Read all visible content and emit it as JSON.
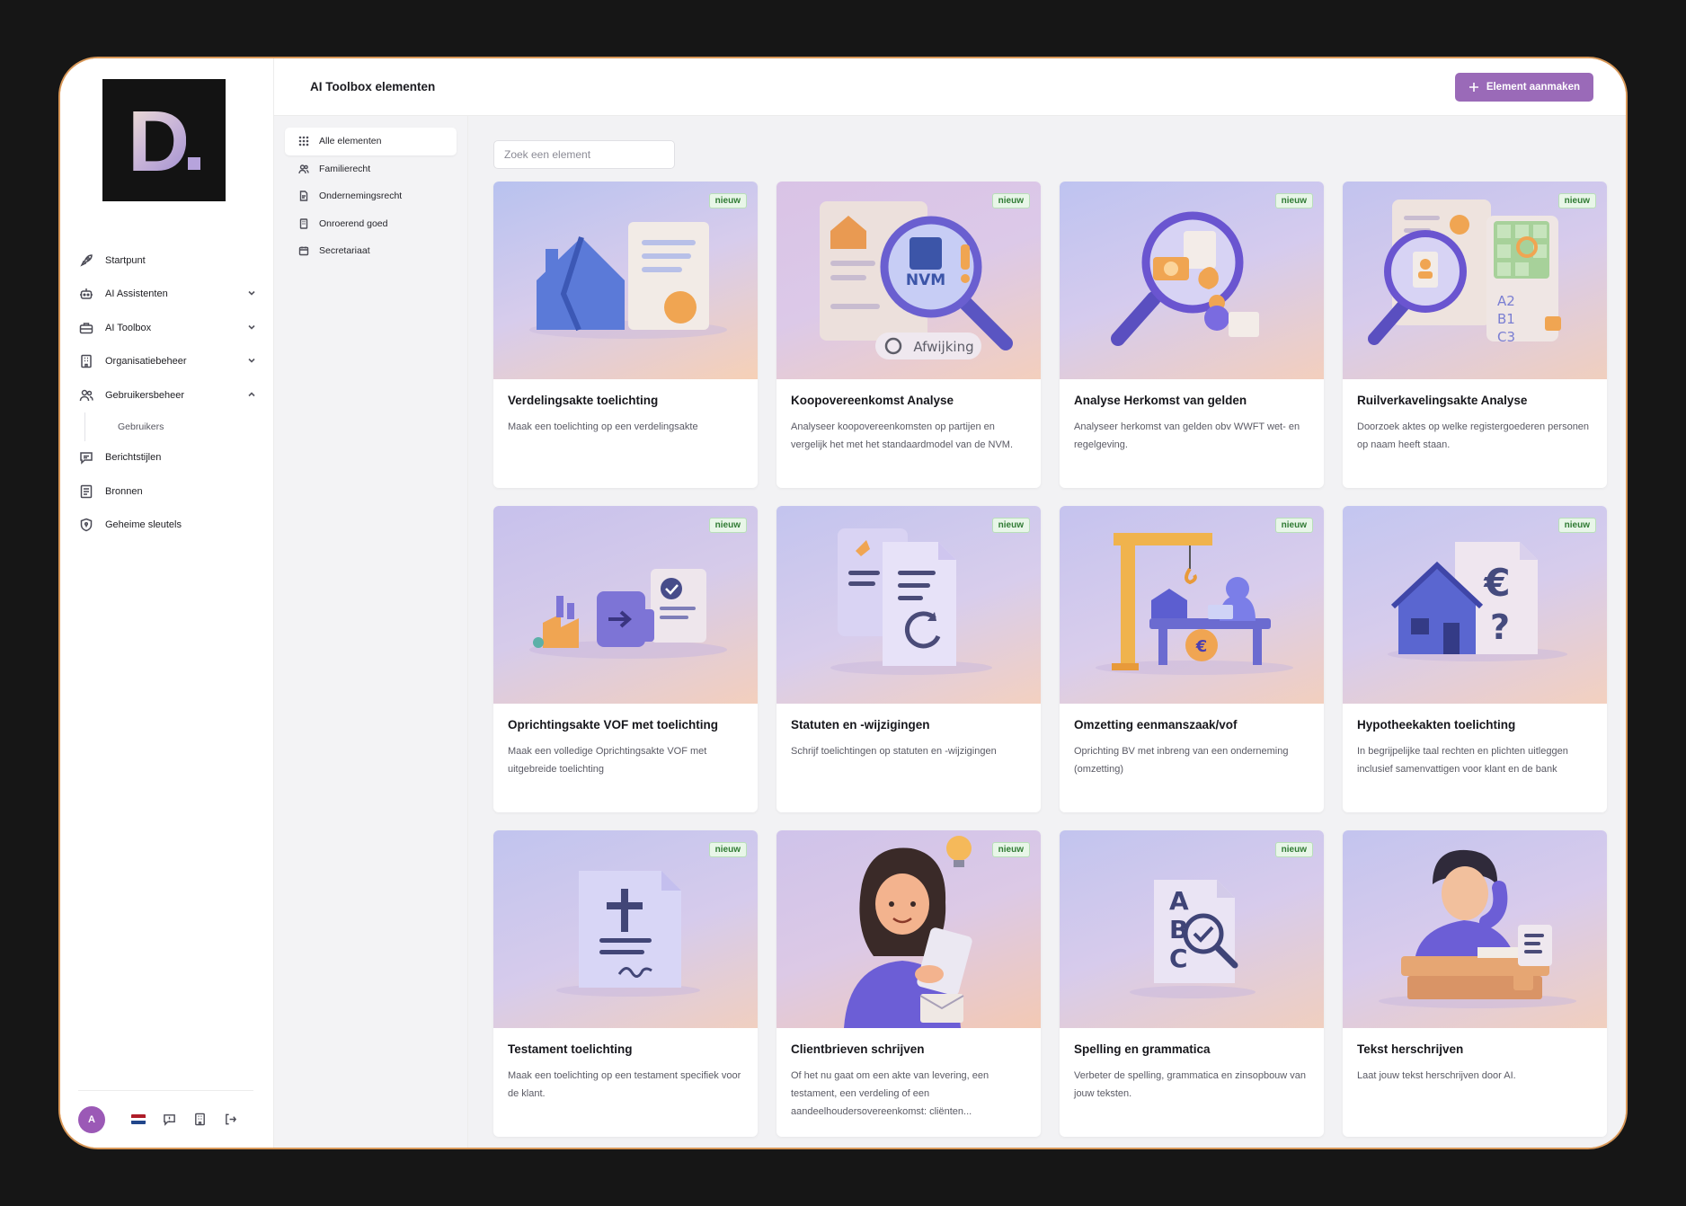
{
  "logo": {
    "letter": "D",
    "icon": "d-logo"
  },
  "sidebar": {
    "items": [
      {
        "label": "Startpunt",
        "icon": "rocket-icon",
        "chevron": ""
      },
      {
        "label": "AI Assistenten",
        "icon": "bot-icon",
        "chevron": "down"
      },
      {
        "label": "AI Toolbox",
        "icon": "toolbox-icon",
        "chevron": "down"
      },
      {
        "label": "Organisatiebeheer",
        "icon": "building-icon",
        "chevron": "down"
      },
      {
        "label": "Gebruikersbeheer",
        "icon": "users-icon",
        "chevron": "up"
      },
      {
        "label": "Berichtstijlen",
        "icon": "message-icon",
        "chevron": ""
      },
      {
        "label": "Bronnen",
        "icon": "book-icon",
        "chevron": ""
      },
      {
        "label": "Geheime sleutels",
        "icon": "shield-icon",
        "chevron": ""
      }
    ],
    "sub_item": "Gebruikers",
    "avatar_initial": "A"
  },
  "header": {
    "title": "AI Toolbox elementen",
    "create_button": "Element aanmaken"
  },
  "categories": [
    {
      "label": "Alle elementen",
      "icon": "grid-icon",
      "active": true
    },
    {
      "label": "Familierecht",
      "icon": "users-icon",
      "active": false
    },
    {
      "label": "Ondernemingsrecht",
      "icon": "document-icon",
      "active": false
    },
    {
      "label": "Onroerend goed",
      "icon": "building-icon",
      "active": false
    },
    {
      "label": "Secretariaat",
      "icon": "calendar-icon",
      "active": false
    }
  ],
  "search": {
    "placeholder": "Zoek een element"
  },
  "badge_label": "nieuw",
  "cards": [
    {
      "title": "Verdelingsakte toelichting",
      "desc": "Maak een toelichting op een verdelingsakte",
      "isNew": true,
      "art": "house-document"
    },
    {
      "title": "Koopovereenkomst Analyse",
      "desc": "Analyseer koopovereenkomsten op partijen en vergelijk het met het standaardmodel van de NVM.",
      "isNew": true,
      "art": "magnifier-nvm",
      "art_text_1": "NVM",
      "art_text_2": "Afwijking"
    },
    {
      "title": "Analyse Herkomst van gelden",
      "desc": "Analyseer herkomst van gelden obv WWFT wet- en regelgeving.",
      "isNew": true,
      "art": "magnifier-euro"
    },
    {
      "title": "Ruilverkavelingsakte Analyse",
      "desc": "Doorzoek aktes op welke registergoederen personen op naam heeft staan.",
      "isNew": true,
      "art": "magnifier-grid",
      "art_text_1": "A2",
      "art_text_2": "B1",
      "art_text_3": "C3"
    },
    {
      "title": "Oprichtingsakte VOF met toelichting",
      "desc": "Maak een volledige Oprichtingsakte VOF met uitgebreide toelichting",
      "isNew": true,
      "art": "factory-arrow"
    },
    {
      "title": "Statuten en -wijzigingen",
      "desc": "Schrijf toelichtingen op statuten en -wijzigingen",
      "isNew": true,
      "art": "documents-refresh"
    },
    {
      "title": "Omzetting eenmanszaak/vof",
      "desc": "Oprichting BV met inbreng van een onderneming (omzetting)",
      "isNew": true,
      "art": "crane-office"
    },
    {
      "title": "Hypotheekakten toelichting",
      "desc": "In begrijpelijke taal rechten en plichten uitleggen inclusief samenvattigen voor klant en de bank",
      "isNew": true,
      "art": "house-euro"
    },
    {
      "title": "Testament toelichting",
      "desc": "Maak een toelichting op een testament specifiek voor de klant.",
      "isNew": true,
      "art": "testament"
    },
    {
      "title": "Clientbrieven schrijven",
      "desc": "Of het nu gaat om een akte van levering, een testament, een verdeling of een aandeelhoudersovereenkomst: cliënten...",
      "isNew": true,
      "art": "woman-tablet"
    },
    {
      "title": "Spelling en grammatica",
      "desc": "Verbeter de spelling, grammatica en zinsopbouw van jouw teksten.",
      "isNew": true,
      "art": "abc-check",
      "art_text_1": "A",
      "art_text_2": "B",
      "art_text_3": "C"
    },
    {
      "title": "Tekst herschrijven",
      "desc": "Laat jouw tekst herschrijven door AI.",
      "isNew": false,
      "art": "man-writing"
    }
  ],
  "colors": {
    "accent": "#9a6ab8",
    "frame_border": "#d99858",
    "badge_bg": "#e8f6e8",
    "badge_text": "#2f7a33",
    "avatar": "#9b59b6"
  }
}
